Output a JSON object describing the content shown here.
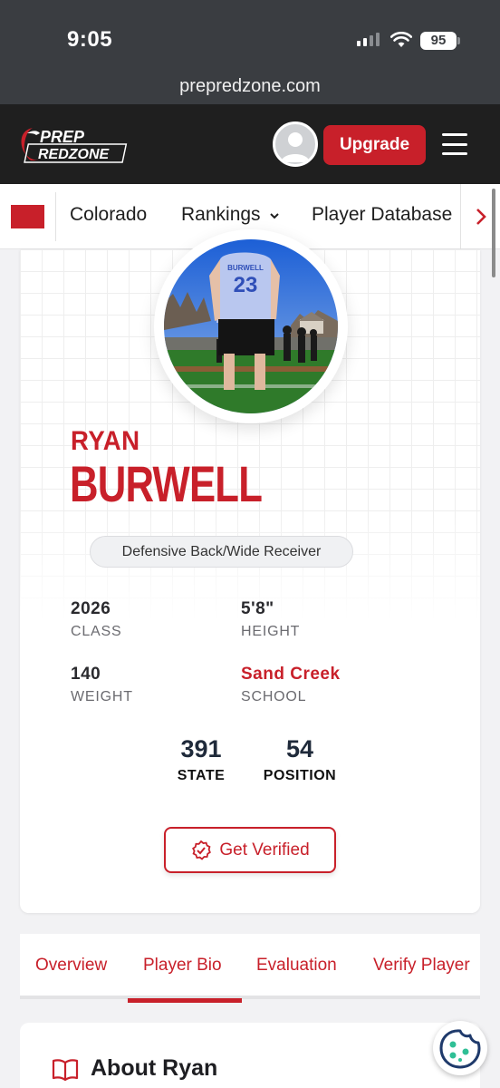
{
  "status_bar": {
    "time": "9:05",
    "battery": "95"
  },
  "browser": {
    "url": "prepredzone.com"
  },
  "header": {
    "logo_line1": "PREP",
    "logo_line2": "REDZONE",
    "upgrade_label": "Upgrade"
  },
  "subnav": {
    "items": [
      "Colorado",
      "Rankings",
      "Player Database"
    ]
  },
  "player": {
    "first_name": "RYAN",
    "last_name": "BURWELL",
    "position": "Defensive Back/Wide Receiver",
    "jersey_number": "23",
    "jersey_name": "BURWELL",
    "stats": [
      {
        "value": "2026",
        "label": "CLASS"
      },
      {
        "value": "5'8\"",
        "label": "HEIGHT"
      },
      {
        "value": "140",
        "label": "WEIGHT"
      },
      {
        "value": "Sand Creek",
        "label": "SCHOOL"
      }
    ],
    "rankings": [
      {
        "value": "391",
        "label": "STATE"
      },
      {
        "value": "54",
        "label": "POSITION"
      }
    ],
    "verify_label": "Get Verified"
  },
  "tabs": {
    "items": [
      "Overview",
      "Player Bio",
      "Evaluation",
      "Verify Player"
    ],
    "active": "Player Bio"
  },
  "about": {
    "title": "About Ryan"
  },
  "colors": {
    "brand_red": "#c8202a",
    "header_dark": "#1f1f1f"
  }
}
